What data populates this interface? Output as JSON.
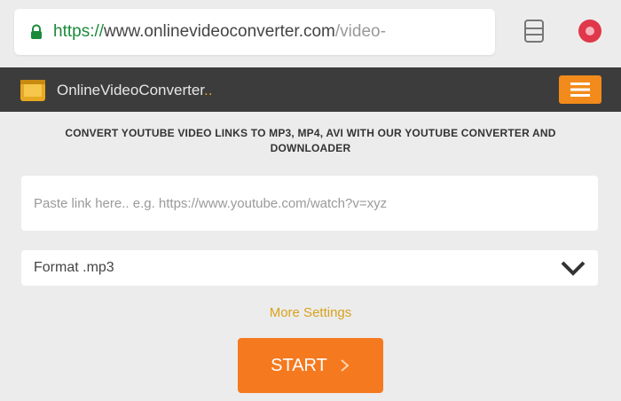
{
  "browser": {
    "url_scheme": "https://",
    "url_host": "www.onlinevideoconverter.com",
    "url_rest": "/video-",
    "lock_icon": "lock-icon",
    "tabs_icon": "tabs-icon",
    "menu_icon": "menu-icon"
  },
  "header": {
    "logo_name": "OnlineVideoConverter",
    "logo_suffix": "..",
    "logo_icon": "film-clapper-icon",
    "menu_icon": "hamburger-icon",
    "accent_color": "#f28b1c"
  },
  "main": {
    "tagline": "CONVERT YOUTUBE VIDEO LINKS TO MP3, MP4, AVI WITH OUR YOUTUBE CONVERTER AND DOWNLOADER",
    "url_input": {
      "value": "",
      "placeholder": "Paste link here.. e.g. https://www.youtube.com/watch?v=xyz"
    },
    "format": {
      "selected": "Format .mp3",
      "icon": "chevron-down-icon"
    },
    "more_settings": "More Settings",
    "start_button": "START",
    "start_icon": "arrow-right-icon"
  }
}
